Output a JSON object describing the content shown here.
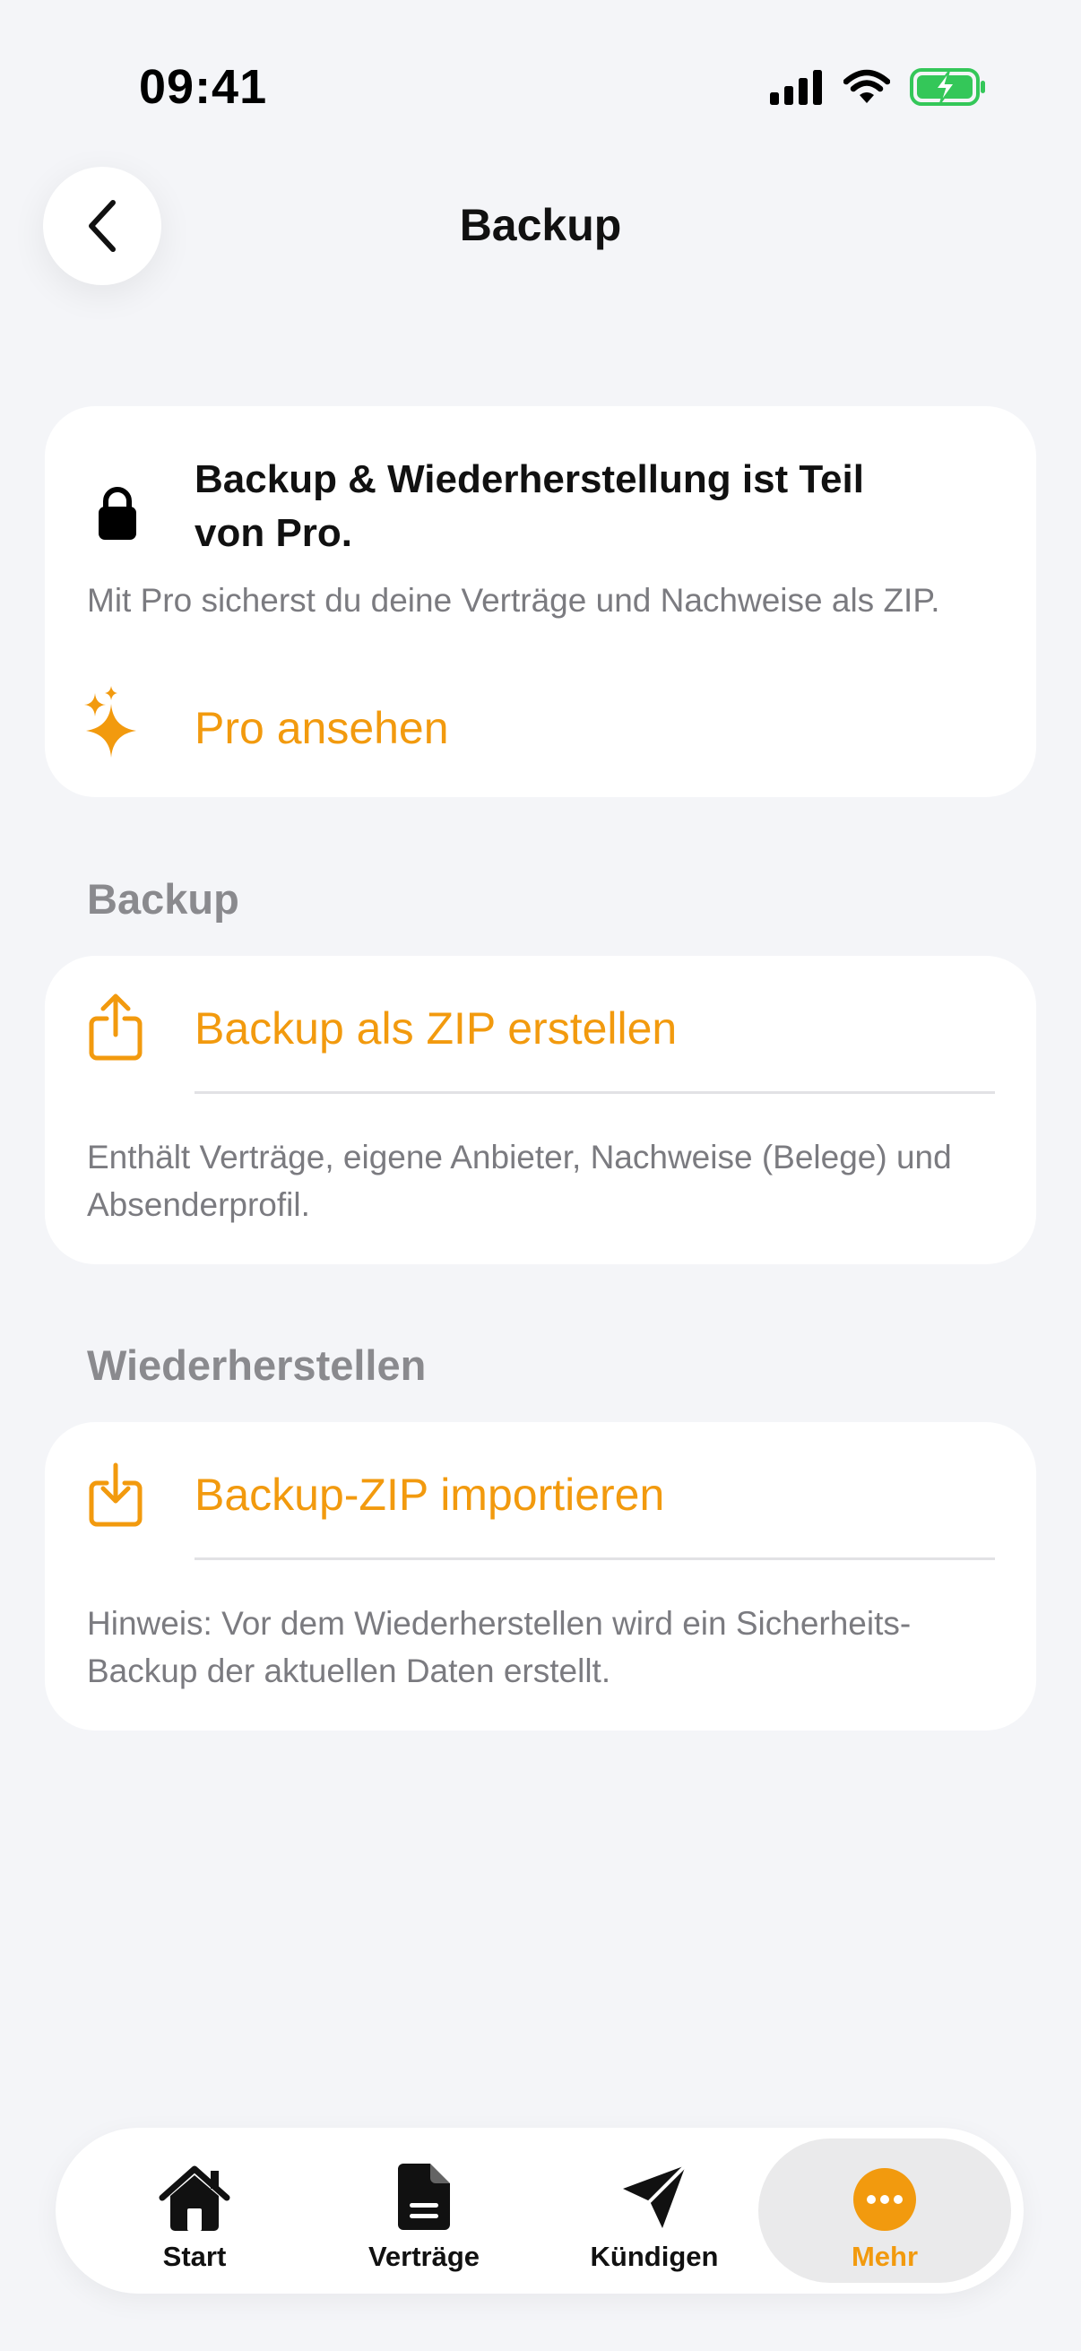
{
  "status_bar": {
    "time": "09:41"
  },
  "nav": {
    "back_icon": "chevron-left-icon",
    "title": "Backup"
  },
  "pro_card": {
    "icon": "lock-icon",
    "title": "Backup & Wiederherstellung ist Teil von Pro.",
    "description": "Mit Pro sicherst du deine Verträge und Nachweise als ZIP.",
    "link_icon": "sparkles-icon",
    "link_label": "Pro ansehen"
  },
  "backup_section": {
    "header": "Backup",
    "action_icon": "share-upload-icon",
    "action_label": "Backup als ZIP erstellen",
    "note": "Enthält Verträge, eigene Anbieter, Nachweise (Belege) und Absenderprofil."
  },
  "restore_section": {
    "header": "Wiederherstellen",
    "action_icon": "download-tray-icon",
    "action_label": "Backup-ZIP importieren",
    "note": "Hinweis: Vor dem Wiederherstellen wird ein Sicherheits-Backup der aktuellen Daten erstellt."
  },
  "tab_bar": {
    "tabs": [
      {
        "label": "Start",
        "icon": "house-icon"
      },
      {
        "label": "Verträge",
        "icon": "document-icon"
      },
      {
        "label": "Kündigen",
        "icon": "paperplane-icon"
      },
      {
        "label": "Mehr",
        "icon": "more-icon"
      }
    ],
    "active_tab": "Mehr"
  },
  "colors": {
    "accent": "#F29A0E",
    "background": "#F4F5F8",
    "secondary_text": "#7B7B80",
    "battery": "#34C759"
  }
}
